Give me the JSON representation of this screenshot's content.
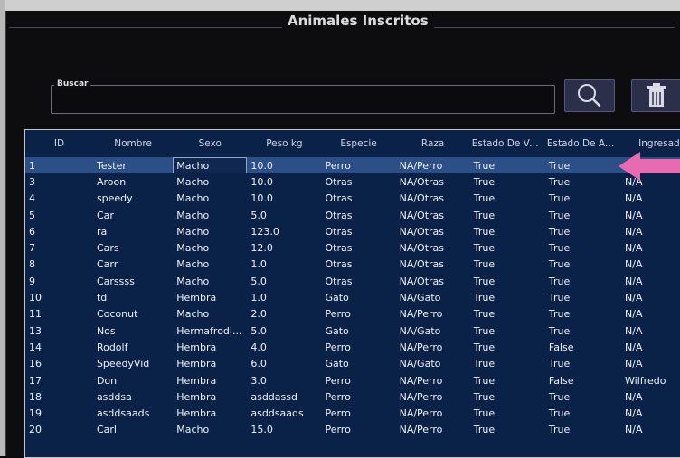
{
  "window": {
    "title": "Animales Inscritos"
  },
  "search": {
    "label": "Buscar",
    "value": ""
  },
  "buttons": {
    "search_icon": "magnifier-icon",
    "delete_icon": "trash-icon"
  },
  "colors": {
    "accent": "#2b4f86",
    "table_bg": "#0b2248",
    "pointer": "#e86ab0"
  },
  "table": {
    "columns": [
      "ID",
      "Nombre",
      "Sexo",
      "Peso kg",
      "Especie",
      "Raza",
      "Estado De Vac...",
      "Estado De Ado...",
      "Ingresado por"
    ],
    "selected_row_index": 0,
    "rows": [
      [
        "1",
        "Tester",
        "Macho",
        "10.0",
        "Perro",
        "NA/Perro",
        "True",
        "True",
        "N/A"
      ],
      [
        "3",
        "Aroon",
        "Macho",
        "10.0",
        "Otras",
        "NA/Otras",
        "True",
        "True",
        "N/A"
      ],
      [
        "4",
        "speedy",
        "Macho",
        "10.0",
        "Otras",
        "NA/Otras",
        "True",
        "True",
        "N/A"
      ],
      [
        "5",
        "Car",
        "Macho",
        "5.0",
        "Otras",
        "NA/Otras",
        "True",
        "True",
        "N/A"
      ],
      [
        "6",
        "ra",
        "Macho",
        "123.0",
        "Otras",
        "NA/Otras",
        "True",
        "True",
        "N/A"
      ],
      [
        "7",
        "Cars",
        "Macho",
        "12.0",
        "Otras",
        "NA/Otras",
        "True",
        "True",
        "N/A"
      ],
      [
        "8",
        "Carr",
        "Macho",
        "1.0",
        "Otras",
        "NA/Otras",
        "True",
        "True",
        "N/A"
      ],
      [
        "9",
        "Carssss",
        "Macho",
        "5.0",
        "Otras",
        "NA/Otras",
        "True",
        "True",
        "N/A"
      ],
      [
        "10",
        "td",
        "Hembra",
        "1.0",
        "Gato",
        "NA/Gato",
        "True",
        "True",
        "N/A"
      ],
      [
        "11",
        "Coconut",
        "Macho",
        "2.0",
        "Perro",
        "NA/Perro",
        "True",
        "True",
        "N/A"
      ],
      [
        "13",
        "Nos",
        "Hermafrodi...",
        "5.0",
        "Gato",
        "NA/Gato",
        "True",
        "True",
        "N/A"
      ],
      [
        "14",
        "Rodolf",
        "Hembra",
        "4.0",
        "Perro",
        "NA/Perro",
        "True",
        "False",
        "N/A"
      ],
      [
        "16",
        "SpeedyVid",
        "Hembra",
        "6.0",
        "Gato",
        "NA/Gato",
        "True",
        "True",
        "N/A"
      ],
      [
        "17",
        "Don",
        "Hembra",
        "3.0",
        "Perro",
        "NA/Perro",
        "True",
        "False",
        "Wilfredo"
      ],
      [
        "18",
        "asddsa",
        "Hembra",
        "asddassd",
        "Perro",
        "NA/Perro",
        "True",
        "True",
        "N/A"
      ],
      [
        "19",
        "asddsaads",
        "Hembra",
        "asddsaads",
        "Perro",
        "NA/Perro",
        "True",
        "True",
        "N/A"
      ],
      [
        "20",
        "Carl",
        "Macho",
        "15.0",
        "Perro",
        "NA/Perro",
        "True",
        "True",
        "N/A"
      ]
    ]
  }
}
